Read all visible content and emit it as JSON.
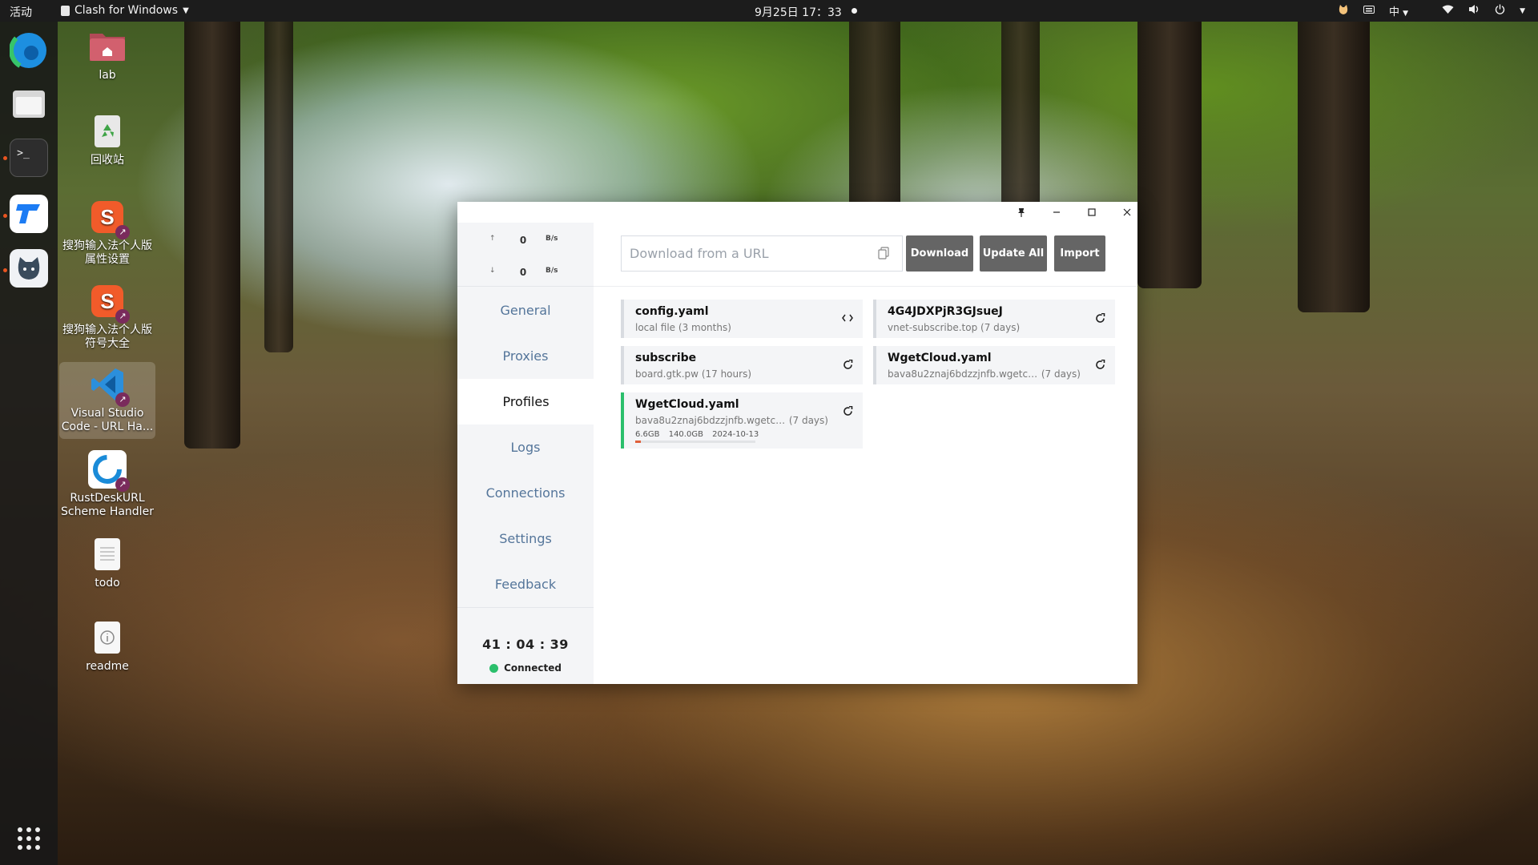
{
  "topbar": {
    "activities": "活动",
    "app_name": "Clash for Windows",
    "clock": "9月25日  17：33",
    "input_method": "中"
  },
  "desktop_icons": [
    {
      "label": "lab"
    },
    {
      "label": "回收站"
    },
    {
      "label": "搜狗输入法个人版 属性设置"
    },
    {
      "label": "搜狗输入法个人版 符号大全"
    },
    {
      "label": "Visual Studio Code - URL Ha..."
    },
    {
      "label": "RustDeskURL Scheme Handler"
    },
    {
      "label": "todo"
    },
    {
      "label": "readme"
    }
  ],
  "clash": {
    "traffic": {
      "up_value": "0",
      "up_unit": "B/s",
      "down_value": "0",
      "down_unit": "B/s"
    },
    "nav": [
      {
        "label": "General"
      },
      {
        "label": "Proxies"
      },
      {
        "label": "Profiles"
      },
      {
        "label": "Logs"
      },
      {
        "label": "Connections"
      },
      {
        "label": "Settings"
      },
      {
        "label": "Feedback"
      }
    ],
    "active_nav": "Profiles",
    "uptime": "41 : 04 : 39",
    "status": "Connected",
    "url_input": {
      "placeholder": "Download from a URL",
      "value": ""
    },
    "buttons": {
      "download": "Download",
      "update_all": "Update All",
      "import": "Import"
    },
    "profiles": [
      {
        "title": "config.yaml",
        "subtitle": "local file",
        "age": "(3 months)",
        "action": "code-icon"
      },
      {
        "title": "4G4JDXPjR3GJsueJ",
        "subtitle": "vnet-subscribe.top",
        "age": "(7 days)",
        "action": "refresh-icon"
      },
      {
        "title": "subscribe",
        "subtitle": "board.gtk.pw",
        "age": "(17 hours)",
        "action": "refresh-icon"
      },
      {
        "title": "WgetCloud.yaml",
        "subtitle": "bava8u2znaj6bdzzjnfb.wgetcl...",
        "age": "(7 days)",
        "action": "refresh-icon"
      },
      {
        "title": "WgetCloud.yaml",
        "subtitle": "bava8u2znaj6bdzzjnfb.wgetcl...",
        "age": "(7 days)",
        "action": "refresh-icon",
        "used": "6.6GB",
        "total": "140.0GB",
        "expire": "2024-10-13",
        "usage_fraction": 0.047,
        "selected": true
      }
    ],
    "colors": {
      "connected": "#2bbf6c",
      "selected_profile": "#2bbf6c",
      "usage_bar": "#e0603a",
      "nav_text": "#54759a"
    }
  }
}
